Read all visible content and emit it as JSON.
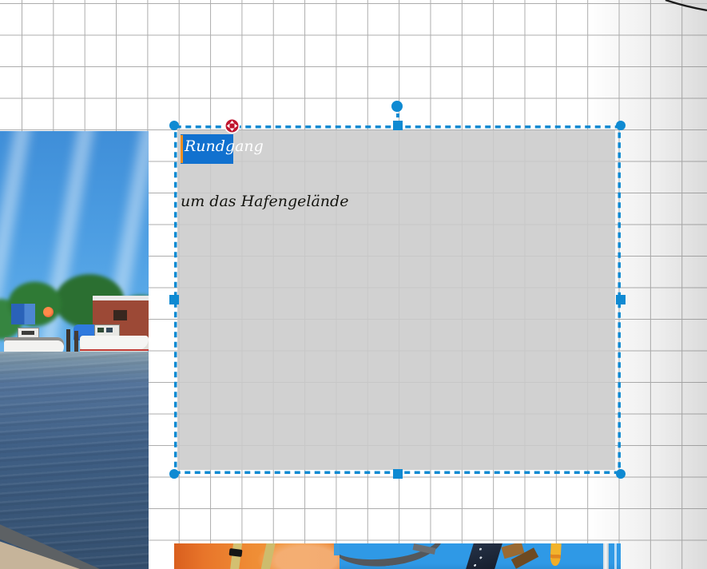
{
  "editor": {
    "selection_color": "#0f8ad2",
    "grid_color": "#adadad",
    "frame_fill_color": "#cbcbcb",
    "text_highlight_color": "#1171cf",
    "caret_color": "#ef8f1f",
    "move_button_color": "#c0152e"
  },
  "text_frame": {
    "line1": "Rundgang",
    "line2": "um das Hafengelände"
  },
  "icons": {
    "move": "move-icon",
    "rotate": "rotate-handle-icon"
  },
  "photos": [
    {
      "name": "harbor-photo",
      "description": "harbor with fishing boats, trees, brick building and blue water"
    },
    {
      "name": "life-vest-photo",
      "description": "orange life vests close-up"
    },
    {
      "name": "rigging-photo",
      "description": "boat rigging against blue sky with yellow flag"
    }
  ]
}
